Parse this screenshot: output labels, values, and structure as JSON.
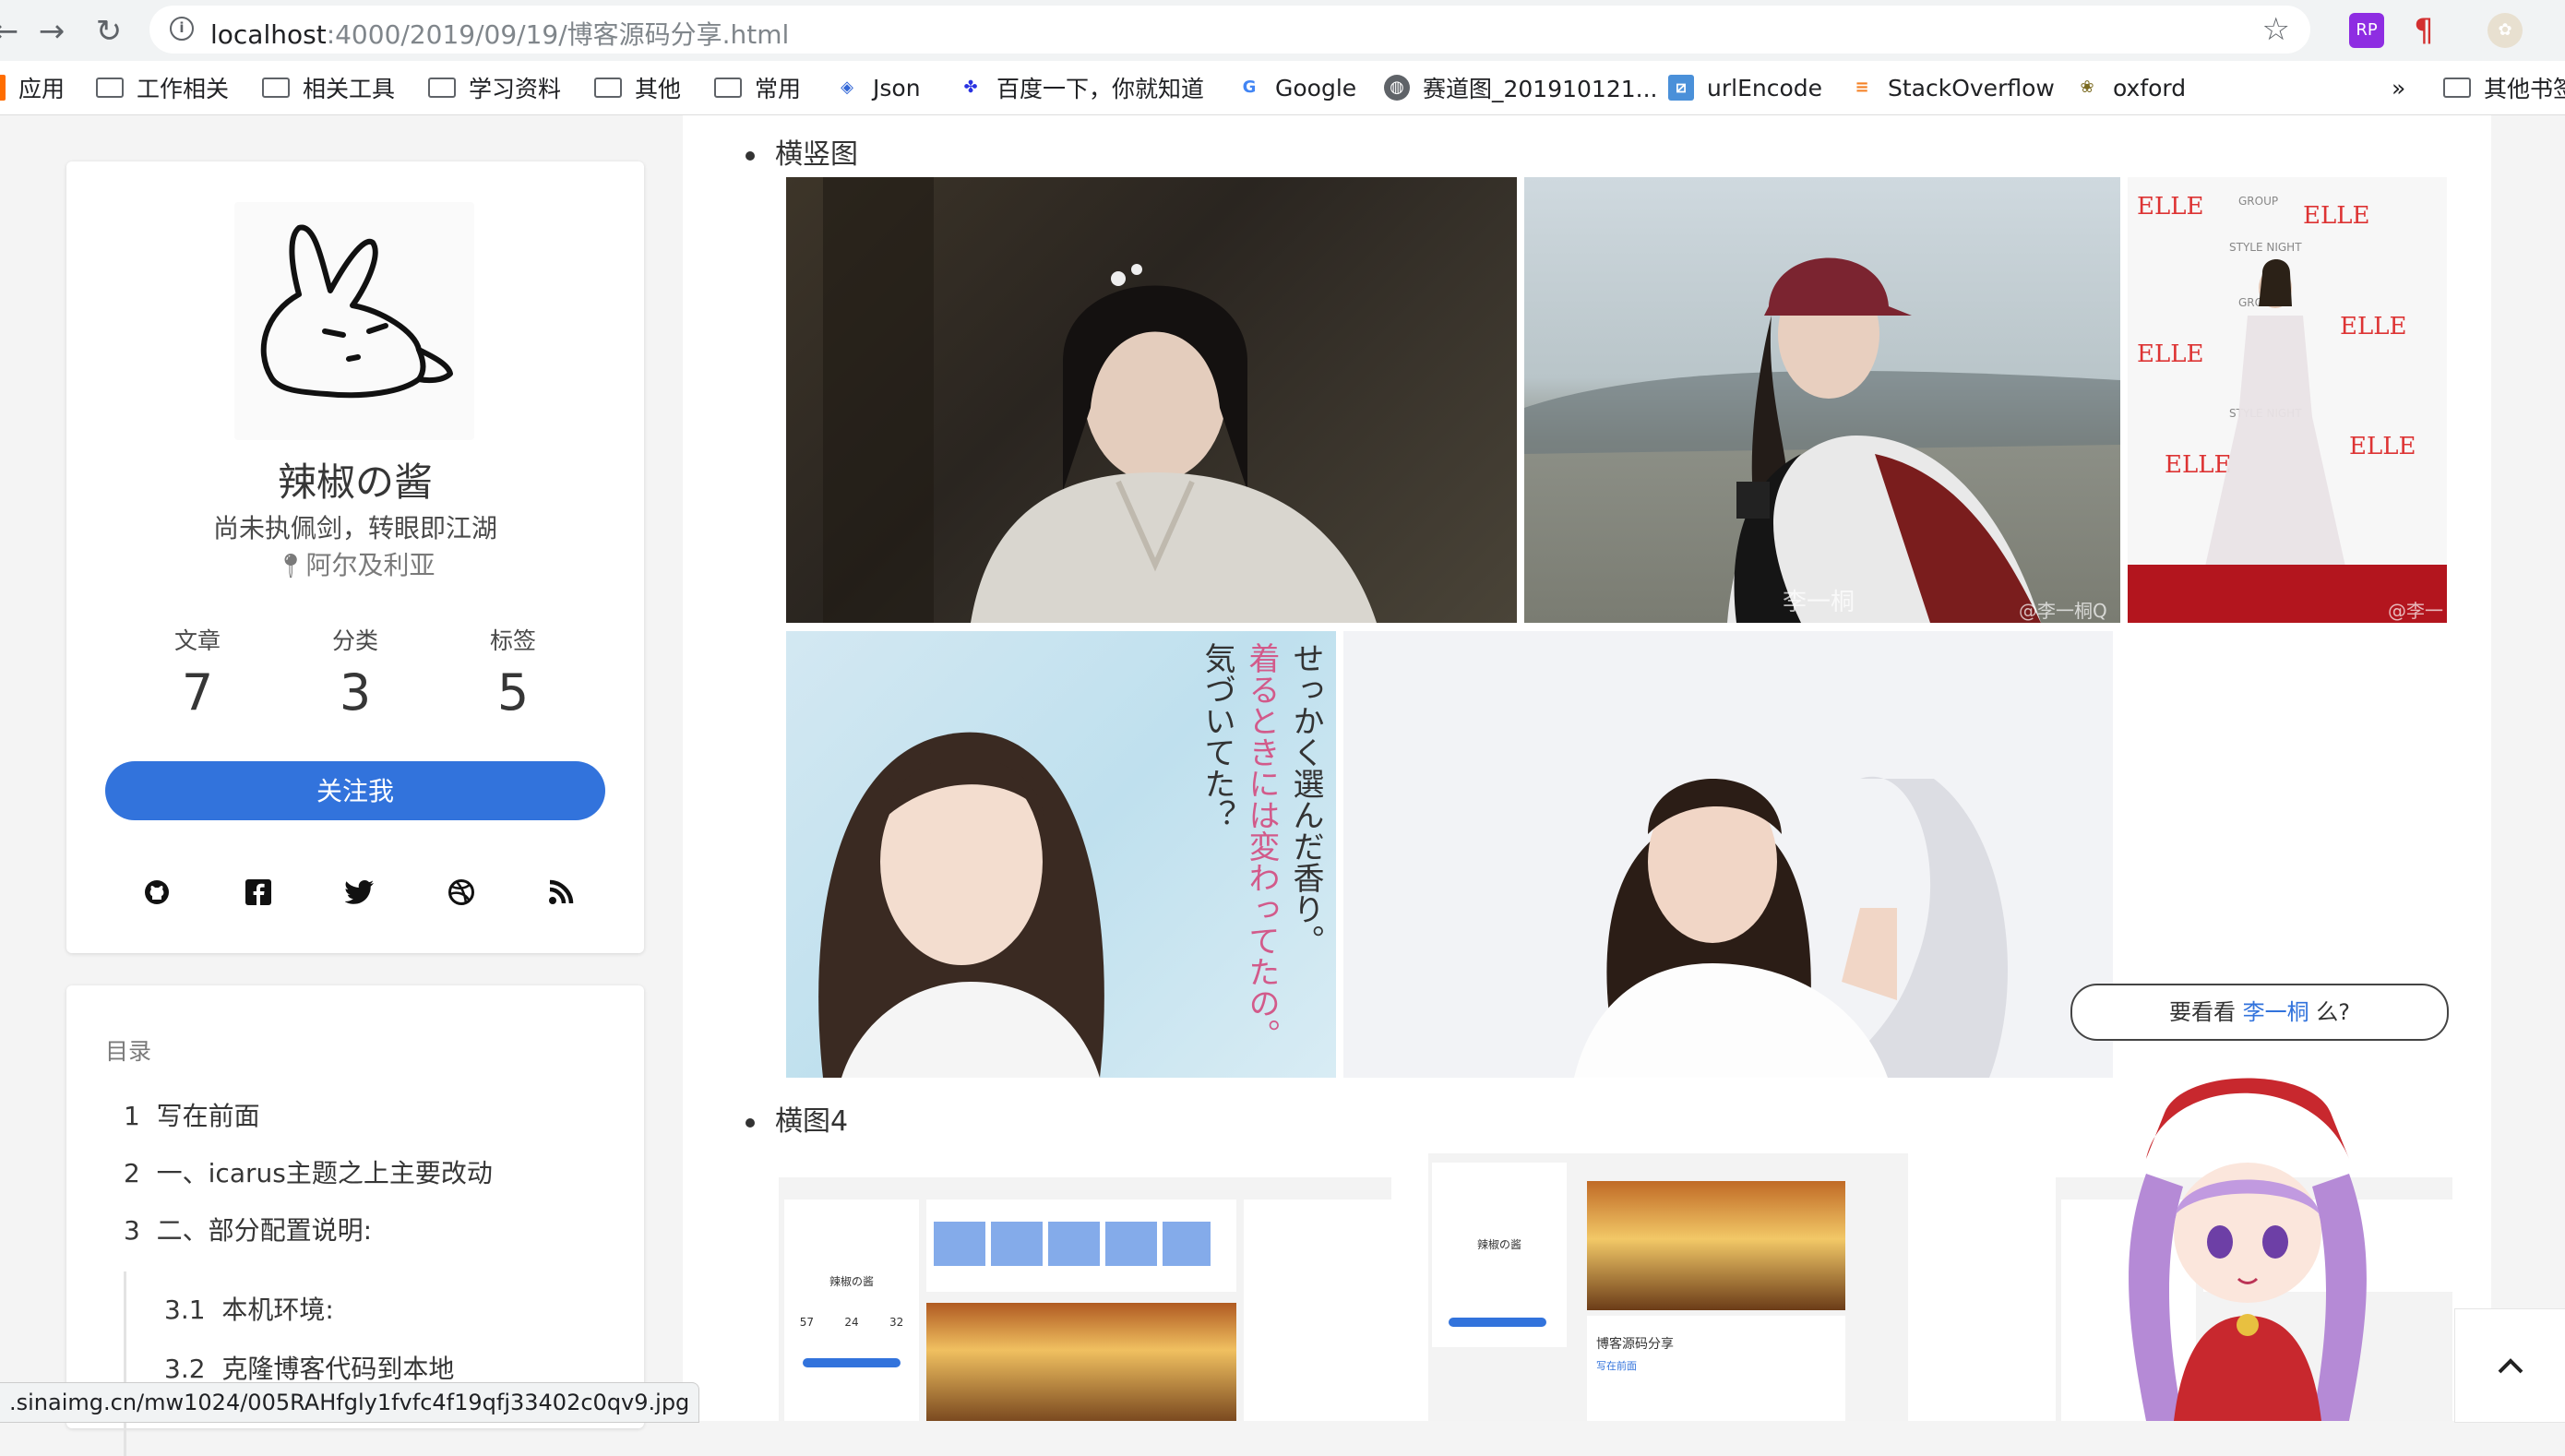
{
  "browser": {
    "url_host": "localhost",
    "url_path": ":4000/2019/09/19/博客源码分享.html"
  },
  "bookmarks": {
    "items": [
      "应用",
      "工作相关",
      "相关工具",
      "学习资料",
      "其他",
      "常用",
      "Json",
      "百度一下，你就知道",
      "Google",
      "赛道图_201910121...",
      "urlEncode",
      "StackOverflow",
      "oxford"
    ],
    "overflow": "»",
    "other": "其他书签"
  },
  "profile": {
    "name": "辣椒の酱",
    "tagline": "尚未执佩剑，转眼即江湖",
    "location": "阿尔及利亚",
    "stats": [
      {
        "label": "文章",
        "value": "7"
      },
      {
        "label": "分类",
        "value": "3"
      },
      {
        "label": "标签",
        "value": "5"
      }
    ],
    "follow_label": "关注我",
    "social": [
      "github-icon",
      "facebook-icon",
      "twitter-icon",
      "dribbble-icon",
      "rss-icon"
    ]
  },
  "toc": {
    "title": "目录",
    "items": [
      {
        "num": "1",
        "text": "写在前面"
      },
      {
        "num": "2",
        "text": "一、icarus主题之上主要改动"
      },
      {
        "num": "3",
        "text": "二、部分配置说明:"
      },
      {
        "num": "3.1",
        "text": "本机环境:"
      },
      {
        "num": "3.2",
        "text": "克隆博客代码到本地"
      }
    ]
  },
  "content": {
    "section1": "横竖图",
    "section2": "横图4",
    "watermark1": "李一桐",
    "watermark2": "@李一桐Q",
    "watermark3": "@李一桐Q",
    "poster_text_a": "せっかく選んだ香り。",
    "poster_text_b": "着るときには変わってたの。",
    "poster_text_c": "気づいてた？"
  },
  "mascot": {
    "speech_prefix": "要看看",
    "speech_link": "李一桐",
    "speech_suffix": "么?"
  },
  "status_url": ".sinaimg.cn/mw1024/005RAHfgly1fvfc4f19qfj33402c0qv9.jpg",
  "thumbs": {
    "blog_name": "辣椒の酱",
    "stats": [
      "57",
      "24",
      "32"
    ],
    "post_title": "博客源码分享",
    "subhead": "写在前面"
  },
  "colors": {
    "accent": "#3273dc",
    "background": "#f4f4f4"
  }
}
